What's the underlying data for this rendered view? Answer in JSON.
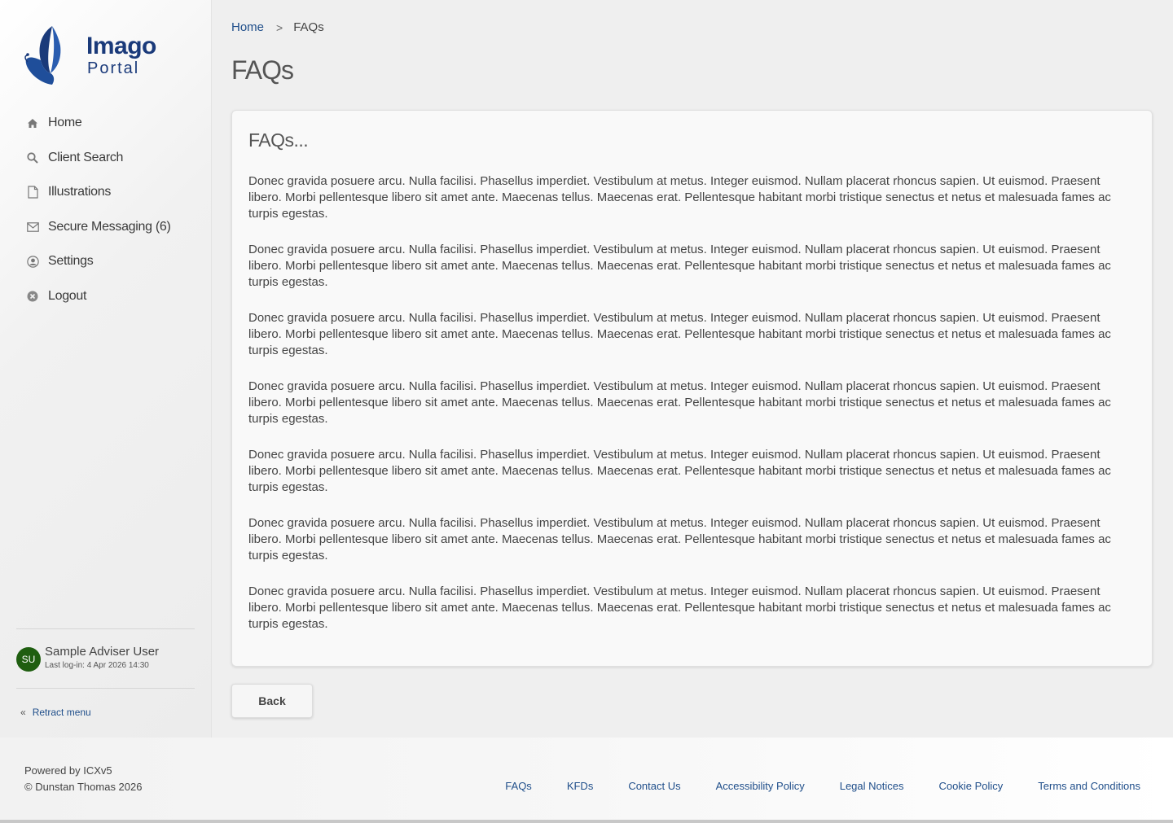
{
  "app": {
    "logo_text_line1": "Imago",
    "logo_text_line2": "Portal",
    "brand_color": "#1a3a7a"
  },
  "sidebar": {
    "items": [
      {
        "label": "Home",
        "icon": "home-icon"
      },
      {
        "label": "Client Search",
        "icon": "search-icon"
      },
      {
        "label": "Illustrations",
        "icon": "document-icon"
      },
      {
        "label": "Secure Messaging (6)",
        "icon": "envelope-icon"
      },
      {
        "label": "Settings",
        "icon": "user-circle-icon"
      },
      {
        "label": "Logout",
        "icon": "close-circle-icon"
      }
    ],
    "user": {
      "initials": "SU",
      "name": "Sample Adviser User",
      "last_login": "Last log-in: 4 Apr 2026 14:30",
      "avatar_color": "#1f5e10"
    },
    "retract_label": "Retract menu"
  },
  "breadcrumb": {
    "home": "Home",
    "separator": ">",
    "current": "FAQs"
  },
  "page": {
    "title": "FAQs",
    "card_title": "FAQs...",
    "paragraphs": [
      "Donec gravida posuere arcu. Nulla facilisi. Phasellus imperdiet. Vestibulum at metus. Integer euismod. Nullam placerat rhoncus sapien. Ut euismod. Praesent libero. Morbi pellentesque libero sit amet ante. Maecenas tellus. Maecenas erat. Pellentesque habitant morbi tristique senectus et netus et malesuada fames ac turpis egestas.",
      "Donec gravida posuere arcu. Nulla facilisi. Phasellus imperdiet. Vestibulum at metus. Integer euismod. Nullam placerat rhoncus sapien. Ut euismod. Praesent libero. Morbi pellentesque libero sit amet ante. Maecenas tellus. Maecenas erat. Pellentesque habitant morbi tristique senectus et netus et malesuada fames ac turpis egestas.",
      "Donec gravida posuere arcu. Nulla facilisi. Phasellus imperdiet. Vestibulum at metus. Integer euismod. Nullam placerat rhoncus sapien. Ut euismod. Praesent libero. Morbi pellentesque libero sit amet ante. Maecenas tellus. Maecenas erat. Pellentesque habitant morbi tristique senectus et netus et malesuada fames ac turpis egestas.",
      "Donec gravida posuere arcu. Nulla facilisi. Phasellus imperdiet. Vestibulum at metus. Integer euismod. Nullam placerat rhoncus sapien. Ut euismod. Praesent libero. Morbi pellentesque libero sit amet ante. Maecenas tellus. Maecenas erat. Pellentesque habitant morbi tristique senectus et netus et malesuada fames ac turpis egestas.",
      "Donec gravida posuere arcu. Nulla facilisi. Phasellus imperdiet. Vestibulum at metus. Integer euismod. Nullam placerat rhoncus sapien. Ut euismod. Praesent libero. Morbi pellentesque libero sit amet ante. Maecenas tellus. Maecenas erat. Pellentesque habitant morbi tristique senectus et netus et malesuada fames ac turpis egestas.",
      "Donec gravida posuere arcu. Nulla facilisi. Phasellus imperdiet. Vestibulum at metus. Integer euismod. Nullam placerat rhoncus sapien. Ut euismod. Praesent libero. Morbi pellentesque libero sit amet ante. Maecenas tellus. Maecenas erat. Pellentesque habitant morbi tristique senectus et netus et malesuada fames ac turpis egestas.",
      "Donec gravida posuere arcu. Nulla facilisi. Phasellus imperdiet. Vestibulum at metus. Integer euismod. Nullam placerat rhoncus sapien. Ut euismod. Praesent libero. Morbi pellentesque libero sit amet ante. Maecenas tellus. Maecenas erat. Pellentesque habitant morbi tristique senectus et netus et malesuada fames ac turpis egestas."
    ],
    "back_label": "Back"
  },
  "footer": {
    "powered_by": "Powered by ICXv5",
    "copyright": "© Dunstan Thomas 2026",
    "links": [
      "FAQs",
      "KFDs",
      "Contact Us",
      "Accessibility Policy",
      "Legal Notices",
      "Cookie Policy",
      "Terms and Conditions"
    ],
    "link_color": "#1f4e8a"
  }
}
